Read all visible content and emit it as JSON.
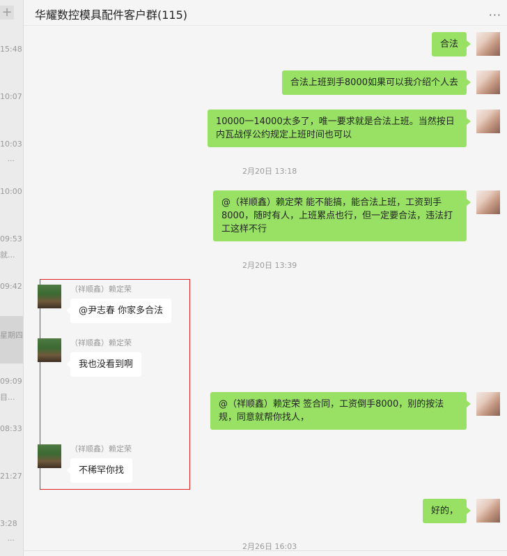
{
  "sidebar": {
    "add_label": "+",
    "items": [
      {
        "time": "15:48",
        "sub": ""
      },
      {
        "time": "10:07",
        "sub": ""
      },
      {
        "time": "10:03",
        "sub": "..."
      },
      {
        "time": "10:00",
        "sub": ""
      },
      {
        "time": "09:53",
        "sub": "就..."
      },
      {
        "time": "09:42",
        "sub": ""
      },
      {
        "time": "星期四",
        "sub": ""
      },
      {
        "time": "09:09",
        "sub": "目..."
      },
      {
        "time": "08:33",
        "sub": ""
      },
      {
        "time": "21:27",
        "sub": ""
      },
      {
        "time": "3:28",
        "sub": "..."
      }
    ]
  },
  "header": {
    "title": "华耀数控模具配件客户群(115)",
    "more_icon": "···"
  },
  "messages": {
    "m1": "合法",
    "m2": "合法上班到手8000如果可以我介绍个人去",
    "m3": "10000一14000太多了，唯一要求就是合法上班。当然按日内瓦战俘公约规定上班时间也可以",
    "t1": "2月20日 13:18",
    "m4": "@（祥顺鑫）赖定荣 能不能搞，能合法上班，工资到手8000，随时有人，上班累点也行，但一定要合法，违法打工这样不行",
    "t2": "2月20日 13:39",
    "r1_sender": "（祥顺鑫）赖定荣",
    "r1": "@尹志春 你家多合法",
    "r2_sender": "（祥顺鑫）赖定荣",
    "r2": "我也没看到啊",
    "m5": "@（祥顺鑫）赖定荣 签合同，工资倒手8000，别的按法规，同意就帮你找人，",
    "r3_sender": "（祥顺鑫）赖定荣",
    "r3": "不稀罕你找",
    "m6": "好的，",
    "t3": "2月26日 16:03"
  },
  "colors": {
    "outgoing_bubble": "#98e165",
    "incoming_bubble": "#ffffff",
    "highlight_box": "#e02020"
  }
}
